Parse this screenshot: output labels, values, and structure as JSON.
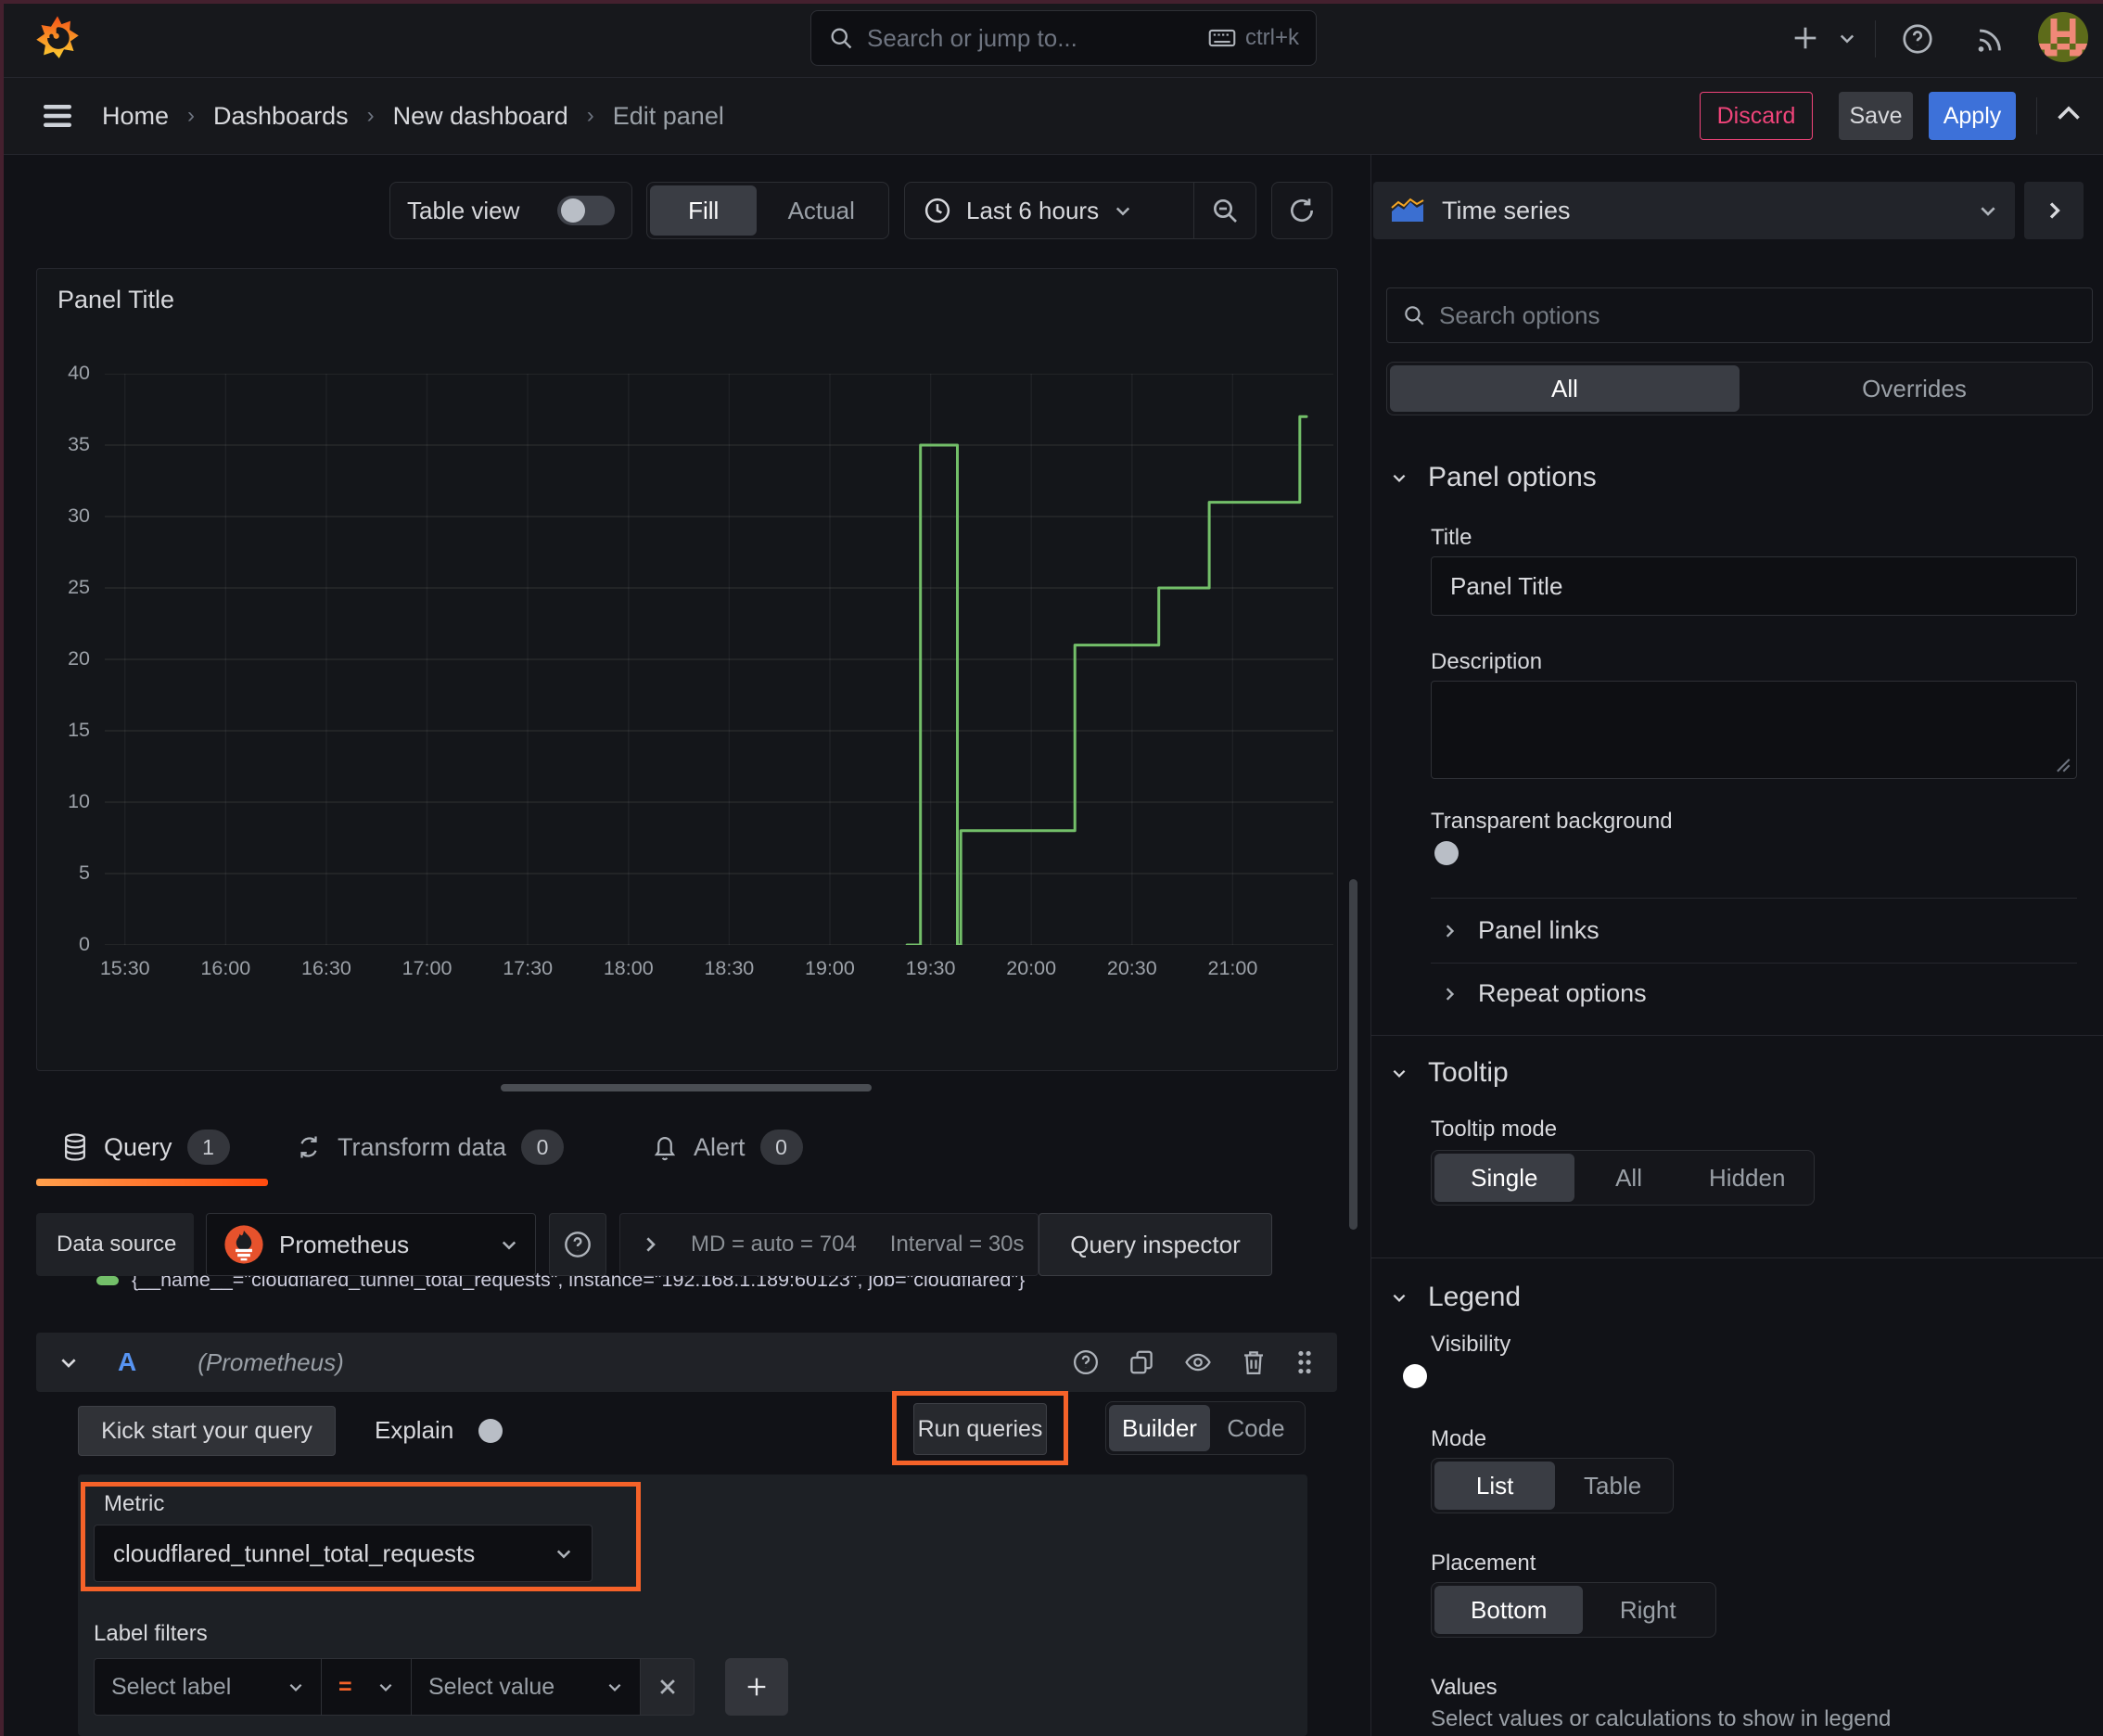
{
  "colors": {
    "accent_orange": "#f56229",
    "series_green": "#73bf69",
    "primary_blue": "#3d71d9",
    "discard_pink": "#f0447a"
  },
  "topnav": {
    "search_placeholder": "Search or jump to...",
    "search_shortcut": "ctrl+k"
  },
  "breadcrumb": {
    "items": [
      "Home",
      "Dashboards",
      "New dashboard",
      "Edit panel"
    ]
  },
  "actions": {
    "discard": "Discard",
    "save": "Save",
    "apply": "Apply"
  },
  "panel_toolbar": {
    "table_view": "Table view",
    "fill": "Fill",
    "actual": "Actual",
    "time_range": "Last 6 hours"
  },
  "panel": {
    "title": "Panel Title"
  },
  "chart_data": {
    "type": "line",
    "title": "Panel Title",
    "x_axis": {
      "unit": "time of day",
      "tick_labels": [
        "15:30",
        "16:00",
        "16:30",
        "17:00",
        "17:30",
        "18:00",
        "18:30",
        "19:00",
        "19:30",
        "20:00",
        "20:30",
        "21:00"
      ],
      "tick_minutes": [
        0,
        30,
        60,
        90,
        120,
        150,
        180,
        210,
        240,
        270,
        300,
        330
      ],
      "range_minutes": [
        -6,
        360
      ]
    },
    "y_axis": {
      "ticks": [
        0,
        5,
        10,
        15,
        20,
        25,
        30,
        35,
        40
      ],
      "range": [
        0,
        40
      ]
    },
    "series": [
      {
        "name": "{__name__=\"cloudflared_tunnel_total_requests\", instance=\"192.168.1.189:60123\", job=\"cloudflared\"}",
        "color": "#73bf69",
        "points_min_value": [
          [
            233,
            0
          ],
          [
            237,
            0
          ],
          [
            237,
            35
          ],
          [
            248,
            35
          ],
          [
            248,
            0
          ],
          [
            249,
            0
          ],
          [
            249,
            8
          ],
          [
            283,
            8
          ],
          [
            283,
            21
          ],
          [
            308,
            21
          ],
          [
            308,
            25
          ],
          [
            323,
            25
          ],
          [
            323,
            31
          ],
          [
            350,
            31
          ],
          [
            350,
            37
          ],
          [
            352,
            37
          ]
        ]
      }
    ],
    "grid": true,
    "legend_position": "bottom"
  },
  "query_tabs": {
    "query": "Query",
    "query_count": "1",
    "transform": "Transform data",
    "transform_count": "0",
    "alert": "Alert",
    "alert_count": "0"
  },
  "datasource_row": {
    "label": "Data source",
    "name": "Prometheus",
    "stats": "MD = auto = 704",
    "interval": "Interval = 30s",
    "inspector": "Query inspector"
  },
  "query_row": {
    "ref_id": "A",
    "ds_hint": "(Prometheus)"
  },
  "query_actions": {
    "kick_start": "Kick start your query",
    "explain": "Explain",
    "run_queries": "Run queries",
    "builder": "Builder",
    "code": "Code"
  },
  "metric": {
    "label": "Metric",
    "value": "cloudflared_tunnel_total_requests"
  },
  "label_filters": {
    "label": "Label filters",
    "select_label": "Select label",
    "operator": "=",
    "select_value": "Select value"
  },
  "viz_picker": {
    "name": "Time series"
  },
  "options_pane": {
    "search_placeholder": "Search options",
    "tab_all": "All",
    "tab_overrides": "Overrides",
    "panel_options": {
      "heading": "Panel options",
      "title_label": "Title",
      "title_value": "Panel Title",
      "description_label": "Description",
      "transparent_label": "Transparent background"
    },
    "panel_links": "Panel links",
    "repeat_options": "Repeat options",
    "tooltip": {
      "heading": "Tooltip",
      "mode_label": "Tooltip mode",
      "single": "Single",
      "all": "All",
      "hidden": "Hidden"
    },
    "legend": {
      "heading": "Legend",
      "visibility_label": "Visibility",
      "mode_label": "Mode",
      "list": "List",
      "table": "Table",
      "placement_label": "Placement",
      "bottom": "Bottom",
      "right": "Right",
      "values_label": "Values",
      "values_help": "Select values or calculations to show in legend"
    }
  }
}
